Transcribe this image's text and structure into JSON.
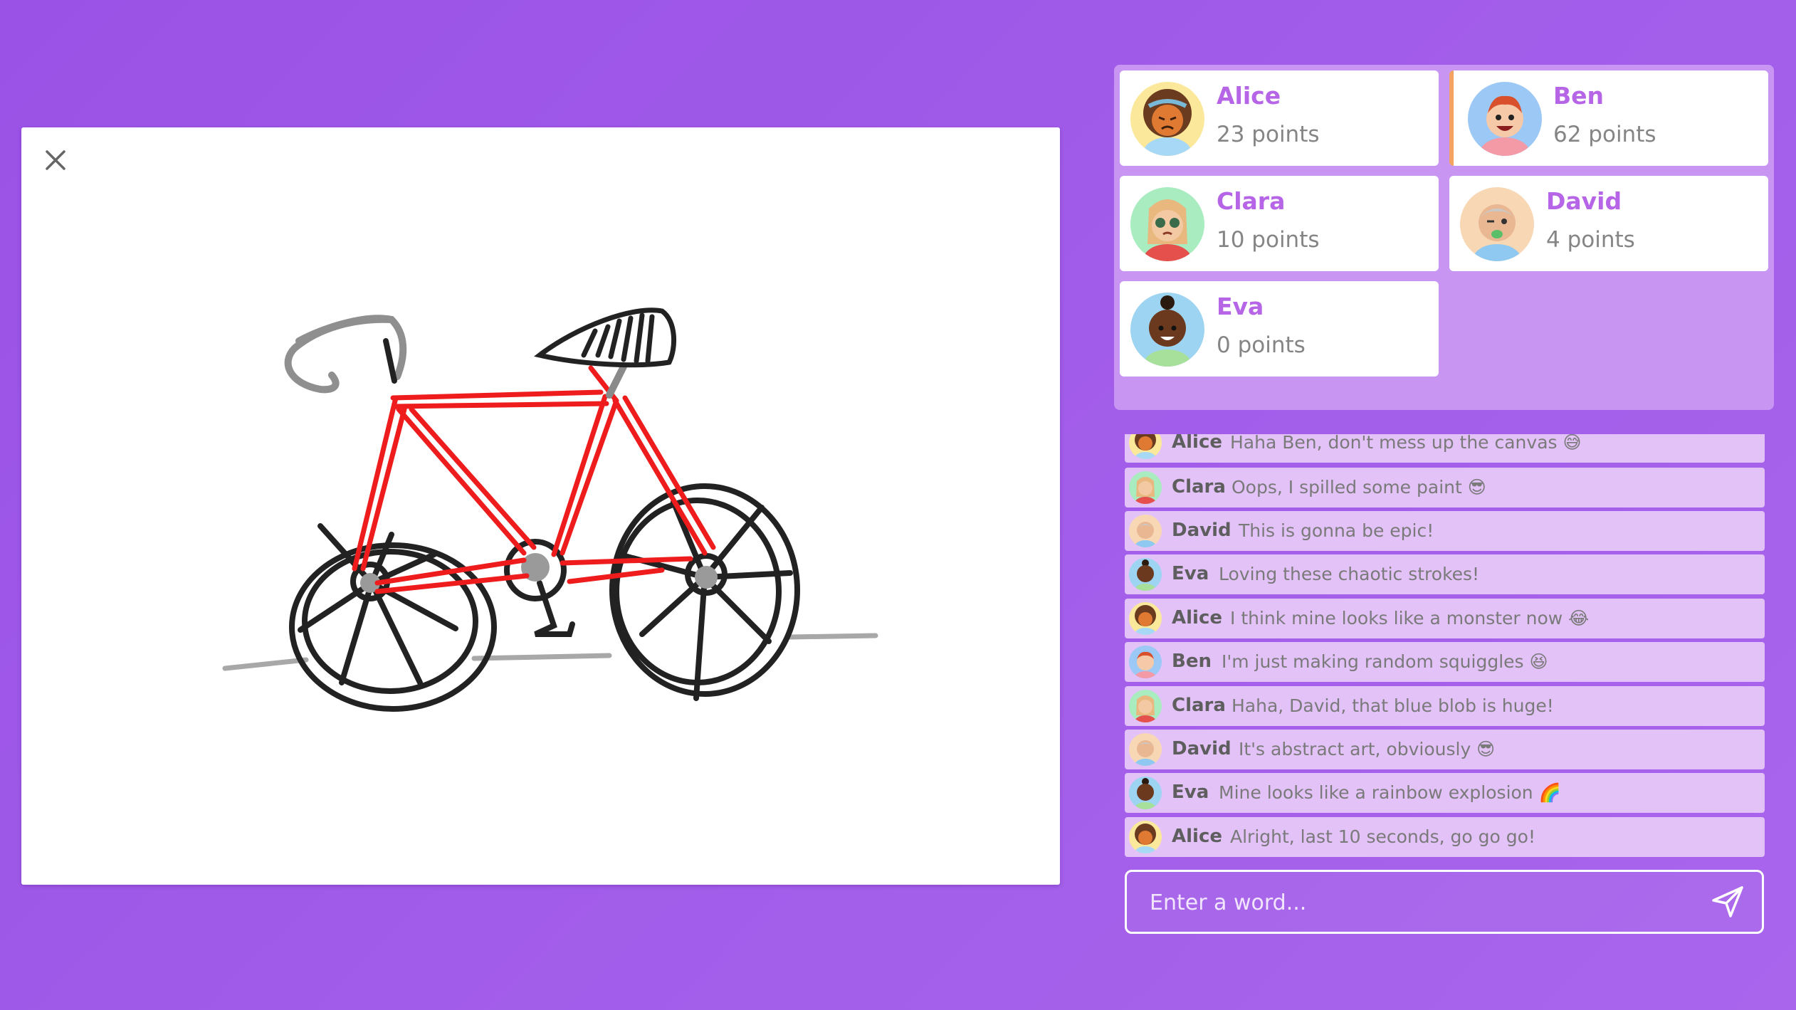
{
  "players": [
    {
      "name": "Alice",
      "points": "23 points",
      "avatar": "avatar-alice",
      "active": false
    },
    {
      "name": "Ben",
      "points": "62 points",
      "avatar": "avatar-ben",
      "active": true
    },
    {
      "name": "Clara",
      "points": "10 points",
      "avatar": "avatar-clara",
      "active": false
    },
    {
      "name": "David",
      "points": "4 points",
      "avatar": "avatar-david",
      "active": false
    },
    {
      "name": "Eva",
      "points": "0 points",
      "avatar": "avatar-eva",
      "active": false
    }
  ],
  "chat": [
    {
      "author": "Alice",
      "text": "Haha Ben, don't mess up the canvas 😅"
    },
    {
      "author": "Clara",
      "text": "Oops, I spilled some paint 😎"
    },
    {
      "author": "David",
      "text": "This is gonna be epic!"
    },
    {
      "author": "Eva",
      "text": "Loving these chaotic strokes!"
    },
    {
      "author": "Alice",
      "text": "I think mine looks like a monster now 😂"
    },
    {
      "author": "Ben",
      "text": "I'm just making random squiggles 😆"
    },
    {
      "author": "Clara",
      "text": "Haha, David, that blue blob is huge!"
    },
    {
      "author": "David",
      "text": "It's abstract art, obviously 😎"
    },
    {
      "author": "Eva",
      "text": "Mine looks like a rainbow explosion 🌈"
    },
    {
      "author": "Alice",
      "text": "Alright, last 10 seconds, go go go!"
    }
  ],
  "input": {
    "placeholder": "Enter a word...",
    "value": ""
  },
  "icons": {
    "close": "close-icon",
    "send": "send-icon"
  },
  "colors": {
    "background": "#a15ce9",
    "panel": "#c896f2",
    "player_name": "#b565e6",
    "chat_row": "#e3c2f8",
    "active_border": "#f4a261",
    "frame_stroke": "#ee1c1c",
    "ink": "#222222",
    "pencil_grey": "#9a9a9a"
  }
}
